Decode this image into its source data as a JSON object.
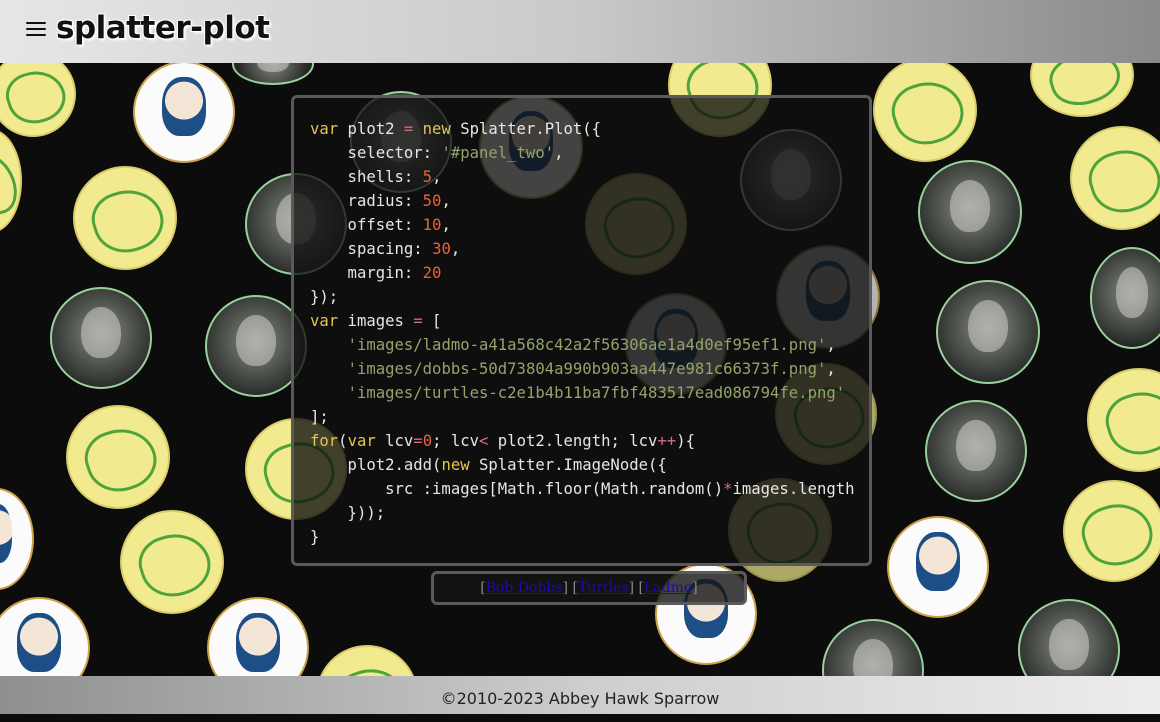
{
  "header": {
    "title": "splatter-plot",
    "menu_icon": "hamburger-menu-icon"
  },
  "code_panel": {
    "language": "javascript",
    "lines": [
      "var plot2 = new Splatter.Plot({",
      "    selector: '#panel_two',",
      "    shells: 5,",
      "    radius: 50,",
      "    offset: 10,",
      "    spacing: 30,",
      "    margin: 20",
      "});",
      "var images = [",
      "    'images/ladmo-a41a568c42a2f56306ae1a4d0ef95ef1.png',",
      "    'images/dobbs-50d73804a990b903aa447e981c66373f.png',",
      "    'images/turtles-c2e1b4b11ba7fbf483517ead086794fe.png'",
      "];",
      "for(var lcv=0; lcv< plot2.length; lcv++){",
      "    plot2.add(new Splatter.ImageNode({",
      "        src :images[Math.floor(Math.random()*images.length",
      "    }));",
      "}"
    ]
  },
  "links": [
    {
      "label": "Bob Dobbs"
    },
    {
      "label": "Turtles"
    },
    {
      "label": "Ladmo"
    }
  ],
  "footer": {
    "text": "©2010-2023 Abbey Hawk Sparrow"
  },
  "colors": {
    "keyword": "#e3c74e",
    "number": "#e8643a",
    "string": "#93a46a",
    "operator": "#d86a8a",
    "background": "#0c0c0c"
  }
}
